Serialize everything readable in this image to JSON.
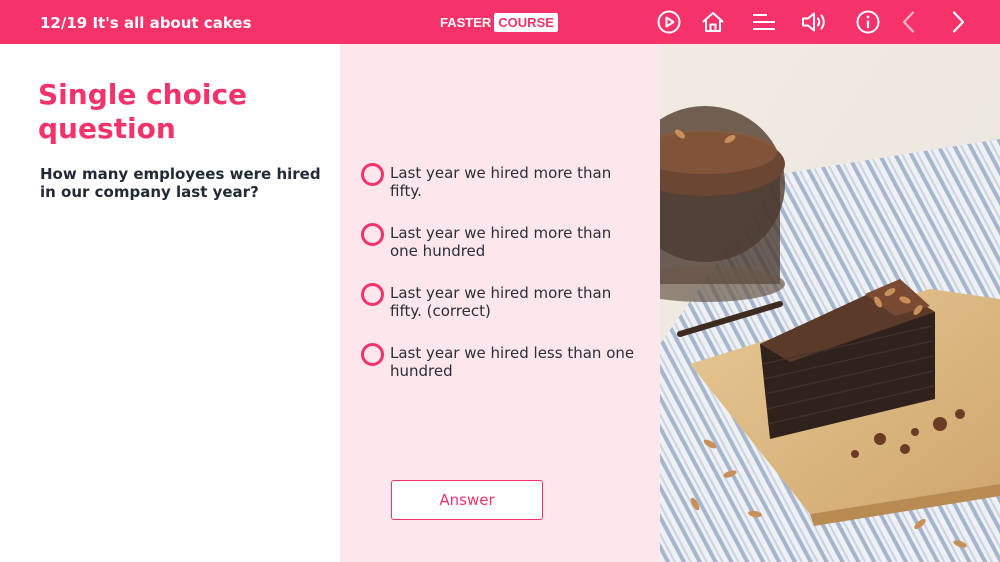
{
  "header": {
    "course_title": "12/19 It's all about cakes",
    "logo_part_1": "FASTER",
    "logo_part_2": "COURSE",
    "icons": [
      "play-circle-icon",
      "home-icon",
      "menu-icon",
      "volume-icon",
      "info-icon",
      "chevron-left-icon",
      "chevron-right-icon"
    ]
  },
  "question": {
    "type_label": "Single choice question",
    "text": "How many employees were hired in our company last year?",
    "options": [
      "Last year we hired more than fifty.",
      "Last year we hired more than one hundred",
      "Last year we hired more than fifty. (correct)",
      "Last year we hired less than one hundred"
    ],
    "answer_label": "Answer"
  },
  "image": {
    "subject": "slice of chocolate crepe cake with almonds on a wooden board"
  },
  "colors": {
    "accent": "#f5336a",
    "panel_bg": "#fde6ec",
    "text_dark": "#222a36"
  }
}
